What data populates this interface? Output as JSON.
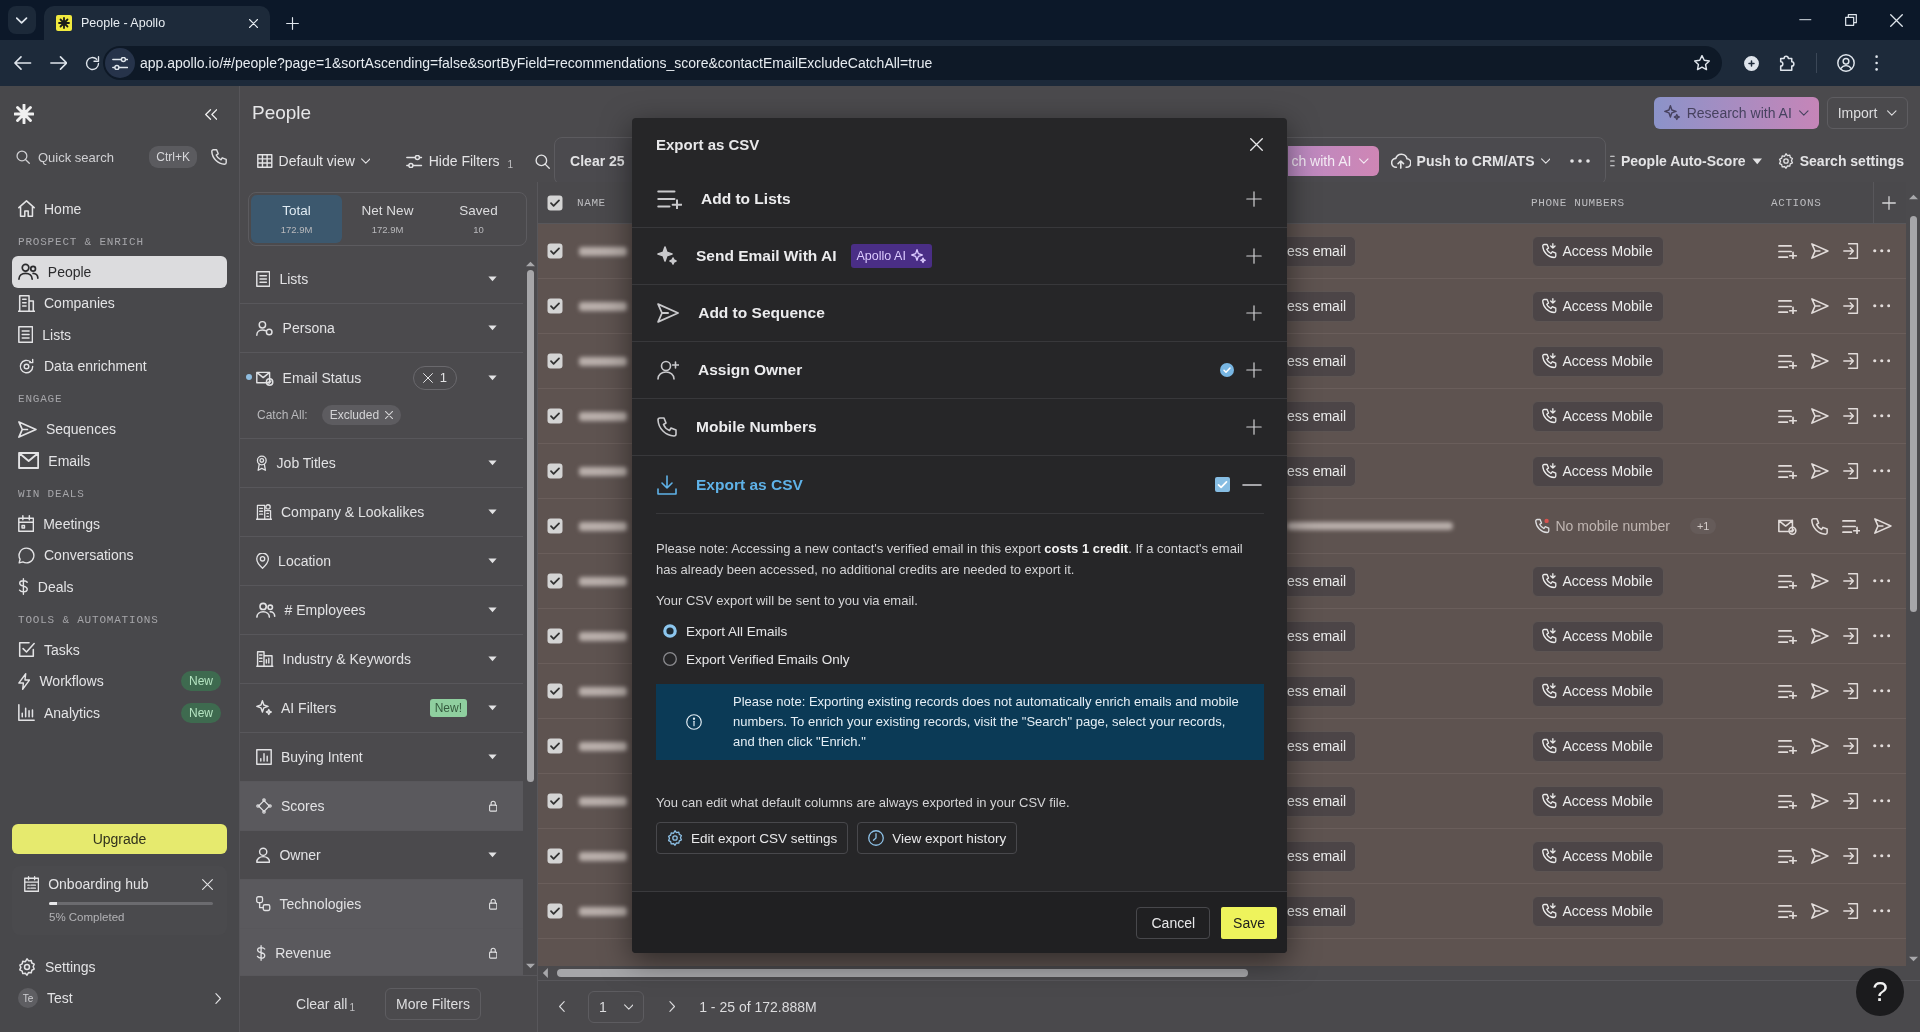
{
  "browser": {
    "tab_title": "People - Apollo",
    "url": "app.apollo.io/#/people?page=1&sortAscending=false&sortByField=recommendations_score&contactEmailExcludeCatchAll=true"
  },
  "sidebar": {
    "quick_search": {
      "label": "Quick search",
      "shortcut": "Ctrl+K"
    },
    "sections": [
      {
        "items": [
          {
            "label": "Home",
            "selected": false
          }
        ]
      },
      {
        "title": "PROSPECT & ENRICH",
        "items": [
          {
            "label": "People",
            "selected": true
          },
          {
            "label": "Companies",
            "selected": false
          },
          {
            "label": "Lists",
            "selected": false
          },
          {
            "label": "Data enrichment",
            "selected": false
          }
        ]
      },
      {
        "title": "ENGAGE",
        "items": [
          {
            "label": "Sequences",
            "selected": false
          },
          {
            "label": "Emails",
            "selected": false
          }
        ]
      },
      {
        "title": "WIN DEALS",
        "items": [
          {
            "label": "Meetings",
            "selected": false
          },
          {
            "label": "Conversations",
            "selected": false
          },
          {
            "label": "Deals",
            "selected": false
          }
        ]
      },
      {
        "title": "TOOLS & AUTOMATIONS",
        "items": [
          {
            "label": "Tasks",
            "selected": false
          },
          {
            "label": "Workflows",
            "selected": false,
            "badge": "New"
          },
          {
            "label": "Analytics",
            "selected": false,
            "badge": "New"
          }
        ]
      }
    ],
    "upgrade": "Upgrade",
    "onboarding": {
      "title": "Onboarding hub",
      "level": 0.05,
      "caption": "5% Completed"
    },
    "settings": "Settings",
    "user": {
      "initials": "Te",
      "name": "Test"
    }
  },
  "header": {
    "title": "People",
    "actions": [
      {
        "label": "Research with AI",
        "kind": "ai"
      },
      {
        "label": "Import",
        "kind": "plain"
      }
    ]
  },
  "toolbar": {
    "view": "Default view",
    "hide_filters": {
      "label": "Hide Filters",
      "count": "1"
    },
    "selection": {
      "clear": "Clear 25",
      "actions": [
        {
          "label": "ch with AI",
          "kind": "ai"
        },
        {
          "label": "Push to CRM/ATS",
          "kind": "push"
        }
      ]
    },
    "auto_score": "People Auto-Score",
    "search_settings": "Search settings"
  },
  "filter_tabs": [
    {
      "label": "Total",
      "count": "172.9M",
      "selected": true
    },
    {
      "label": "Net New",
      "count": "172.9M",
      "selected": false
    },
    {
      "label": "Saved",
      "count": "10",
      "selected": false
    }
  ],
  "filters": [
    {
      "label": "Lists",
      "locked": false,
      "active": false
    },
    {
      "label": "Persona",
      "locked": false,
      "active": false
    },
    {
      "label": "Email Status",
      "locked": false,
      "active": true,
      "count": "1",
      "chips": [
        {
          "label": "Catch All:",
          "value": "Excluded"
        }
      ]
    },
    {
      "label": "Job Titles",
      "locked": false,
      "active": false
    },
    {
      "label": "Company & Lookalikes",
      "locked": false,
      "active": false
    },
    {
      "label": "Location",
      "locked": false,
      "active": false
    },
    {
      "label": "# Employees",
      "locked": false,
      "active": false
    },
    {
      "label": "Industry & Keywords",
      "locked": false,
      "active": false
    },
    {
      "label": "AI Filters",
      "locked": false,
      "active": false,
      "badge": "New!"
    },
    {
      "label": "Buying Intent",
      "locked": false,
      "active": false
    },
    {
      "label": "Scores",
      "locked": true,
      "active": false
    },
    {
      "label": "Owner",
      "locked": false,
      "active": false
    },
    {
      "label": "Technologies",
      "locked": true,
      "active": false
    },
    {
      "label": "Revenue",
      "locked": true,
      "active": false
    }
  ],
  "filter_footer": {
    "clear_all": "Clear all",
    "count": "1",
    "more": "More Filters"
  },
  "table": {
    "all_selected": true,
    "columns": [
      "NAME",
      "PHONE NUMBERS",
      "ACTIONS"
    ],
    "rows": [
      {
        "selected": true,
        "kind": "access",
        "email": "ess email",
        "phone": "Access Mobile"
      },
      {
        "selected": true,
        "kind": "access",
        "email": "ess email",
        "phone": "Access Mobile"
      },
      {
        "selected": true,
        "kind": "access",
        "email": "ess email",
        "phone": "Access Mobile"
      },
      {
        "selected": true,
        "kind": "access",
        "email": "ess email",
        "phone": "Access Mobile"
      },
      {
        "selected": true,
        "kind": "access",
        "email": "ess email",
        "phone": "Access Mobile"
      },
      {
        "selected": true,
        "kind": "no_mobile",
        "phone": "No mobile number",
        "extra": "+1"
      },
      {
        "selected": true,
        "kind": "access",
        "email": "ess email",
        "phone": "Access Mobile"
      },
      {
        "selected": true,
        "kind": "access",
        "email": "ess email",
        "phone": "Access Mobile"
      },
      {
        "selected": true,
        "kind": "access",
        "email": "ess email",
        "phone": "Access Mobile"
      },
      {
        "selected": true,
        "kind": "access",
        "email": "ess email",
        "phone": "Access Mobile"
      },
      {
        "selected": true,
        "kind": "access",
        "email": "ess email",
        "phone": "Access Mobile"
      },
      {
        "selected": true,
        "kind": "access",
        "email": "ess email",
        "phone": "Access Mobile"
      },
      {
        "selected": true,
        "kind": "access",
        "email": "ess email",
        "phone": "Access Mobile"
      }
    ]
  },
  "pagination": {
    "page": "1",
    "range": "1 - 25 of 172.888M"
  },
  "help": "?",
  "modal": {
    "title": "Export as CSV",
    "actions": [
      {
        "label": "Add to Lists",
        "checked": false,
        "expanded": false
      },
      {
        "label": "Send Email With AI",
        "badge": "Apollo AI",
        "checked": false,
        "expanded": false
      },
      {
        "label": "Add to Sequence",
        "checked": false,
        "expanded": false
      },
      {
        "label": "Assign Owner",
        "checked": true,
        "expanded": false
      },
      {
        "label": "Mobile Numbers",
        "checked": false,
        "expanded": false
      },
      {
        "label": "Export as CSV",
        "checked": true,
        "expanded": true
      }
    ],
    "notice": "Please note: Accessing a new contact's verified email in this export **costs 1 credit**. If a contact's email has already been accessed, no additional credits are needed to export it.",
    "delivery": "Your CSV export will be sent to you via email.",
    "options": [
      {
        "label": "Export All Emails",
        "selected": true
      },
      {
        "label": "Export Verified Emails Only",
        "selected": false
      }
    ],
    "info": "Please note: Exporting existing records does not automatically enrich emails and mobile numbers. To enrich your existing records, visit the \"Search\" page, select your records, and then click \"Enrich.\"",
    "columns_note": "You can edit what default columns are always exported in your CSV file.",
    "links": [
      "Edit export CSV settings",
      "View export history"
    ],
    "buttons": [
      {
        "label": "Cancel",
        "kind": "secondary"
      },
      {
        "label": "Save",
        "kind": "primary"
      }
    ]
  }
}
